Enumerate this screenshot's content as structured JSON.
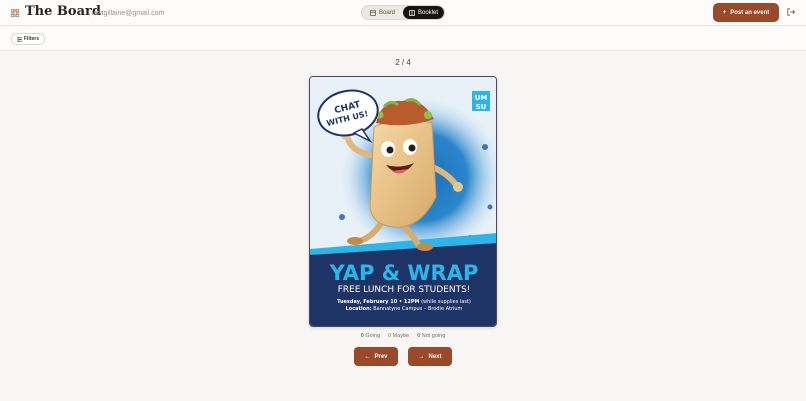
{
  "header": {
    "title": "The Board",
    "email": "laragillaine@gmail.com",
    "view_toggle": [
      {
        "label": "Board",
        "icon": "board-icon",
        "active": false
      },
      {
        "label": "Booklet",
        "icon": "book-icon",
        "active": true
      }
    ],
    "post_button": "Post an event"
  },
  "filterbar": {
    "filters_label": "Filters"
  },
  "main": {
    "counter": "2 / 4",
    "poster": {
      "brand_top": "UM",
      "brand_bottom": "SU",
      "bubble_line1": "CHAT",
      "bubble_line2": "WITH US!",
      "headline": "YAP & WRAP",
      "subheadline": "FREE LUNCH FOR STUDENTS!",
      "date_bold": "Tuesday, February 10 • 12PM",
      "date_rest": " (while supplies last)",
      "location_label": "Location:",
      "location_value": " Bannatyne Campus – Brodie Atrium"
    },
    "rsvp": {
      "going_count": "0",
      "going_label": "Going",
      "maybe_count": "0",
      "maybe_label": "Maybe",
      "not_count": "0",
      "not_label": "Not going"
    },
    "prev_label": "Prev",
    "next_label": "Next"
  },
  "colors": {
    "accent": "#9a4a28",
    "background": "#f8f6f4",
    "poster_navy": "#1f3466",
    "poster_cyan": "#2bb5e8"
  }
}
